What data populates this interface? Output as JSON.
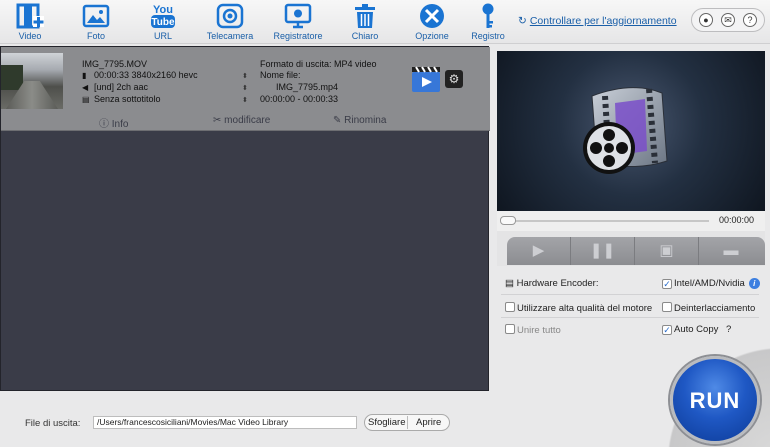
{
  "toolbar": {
    "items": [
      {
        "label": "Video",
        "icon": "add-video-icon"
      },
      {
        "label": "Foto",
        "icon": "photo-icon"
      },
      {
        "label": "URL",
        "icon": "youtube-icon"
      },
      {
        "label": "Telecamera",
        "icon": "camera-icon"
      },
      {
        "label": "Registratore",
        "icon": "screen-recorder-icon"
      },
      {
        "label": "Chiaro",
        "icon": "trash-icon"
      },
      {
        "label": "Opzione",
        "icon": "tools-icon"
      },
      {
        "label": "Registro",
        "icon": "key-icon"
      }
    ],
    "youtube_text": [
      "You",
      "Tube"
    ],
    "update_link": "Controllare per l'aggiornamento",
    "help_buttons": [
      "person-icon",
      "mail-icon",
      "help-icon"
    ]
  },
  "file": {
    "name": "IMG_7795.MOV",
    "video_info": "00:00:33 3840x2160 hevc",
    "audio_info": "[und] 2ch aac",
    "subtitle_info": "Senza sottotitolo",
    "output_format": "Formato di uscita: MP4 video",
    "output_name_label": "Nome file:",
    "output_name": "IMG_7795.mp4",
    "output_range": "00:00:00 - 00:00:33",
    "actions": {
      "info": "Info",
      "edit": "modificare",
      "rename": "Rinomina"
    }
  },
  "player": {
    "time": "00:00:00",
    "controls": [
      "play-icon",
      "pause-icon",
      "snapshot-icon",
      "folder-icon"
    ]
  },
  "options": {
    "hw_encoder_label": "Hardware Encoder:",
    "hw_encoder_value": "Intel/AMD/Nvidia",
    "hw_encoder_checked": true,
    "high_quality": "Utilizzare alta qualità del motore",
    "high_quality_checked": false,
    "deinterlace": "Deinterlacciamento",
    "deinterlace_checked": false,
    "merge_all": "Unire tutto",
    "merge_all_checked": false,
    "auto_copy": "Auto Copy",
    "auto_copy_checked": true,
    "auto_copy_help": "?"
  },
  "bottom": {
    "output_label": "File di uscita:",
    "output_path": "/Users/francescosiciliani/Movies/Mac Video Library",
    "browse": "Sfogliare",
    "open": "Aprire"
  },
  "run_label": "RUN"
}
